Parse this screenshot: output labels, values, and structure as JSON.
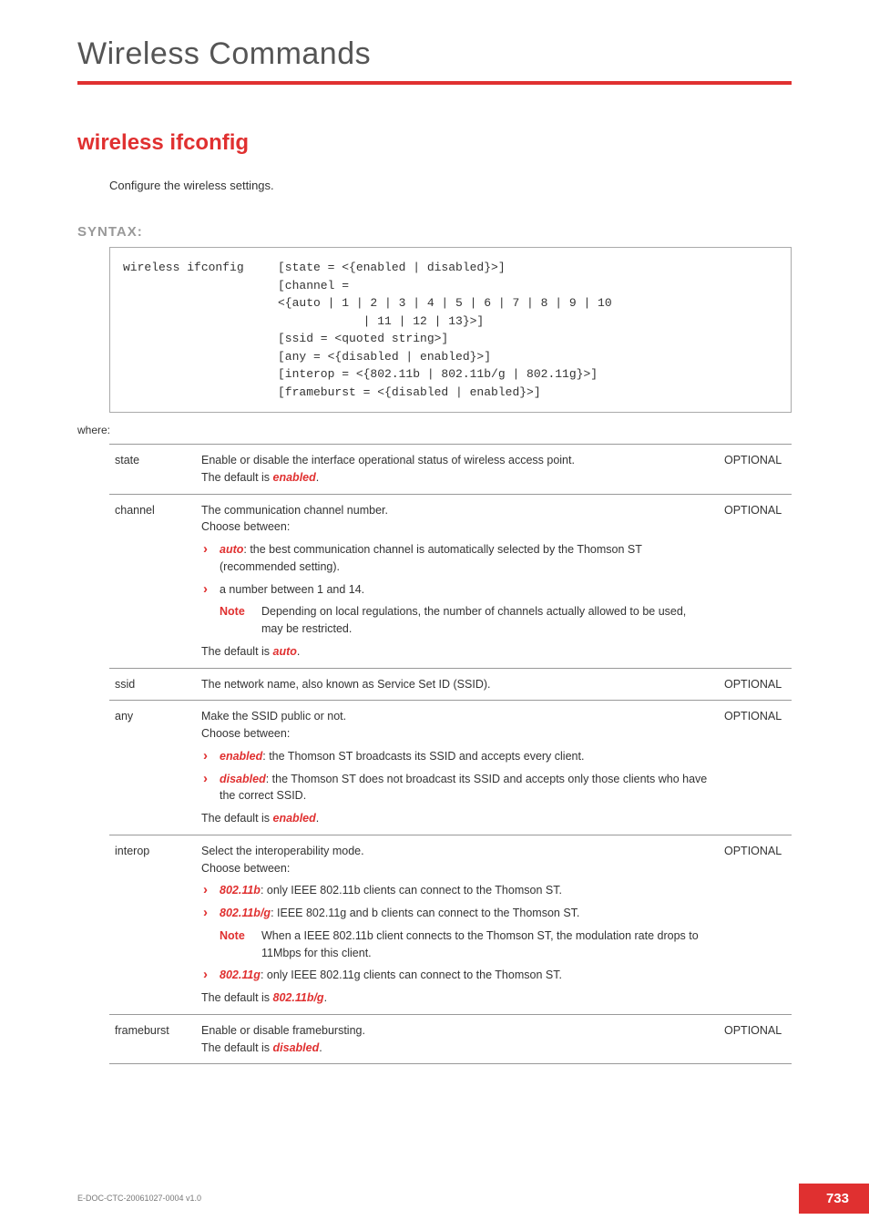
{
  "chapter": "Wireless Commands",
  "command_title": "wireless ifconfig",
  "command_desc": "Configure the wireless settings.",
  "syntax_label": "SYNTAX:",
  "syntax_cmd": "wireless ifconfig",
  "syntax_args": "[state = <{enabled | disabled}>]\n[channel =\n<{auto | 1 | 2 | 3 | 4 | 5 | 6 | 7 | 8 | 9 | 10\n            | 11 | 12 | 13}>]\n[ssid = <quoted string>]\n[any = <{disabled | enabled}>]\n[interop = <{802.11b | 802.11b/g | 802.11g}>]\n[frameburst = <{disabled | enabled}>]",
  "where_label": "where:",
  "optional_label": "OPTIONAL",
  "note_label": "Note",
  "params": {
    "state": {
      "name": "state",
      "desc_pre": "Enable or disable the interface operational status of wireless access point.",
      "default_pre": "The default is ",
      "default_val": "enabled",
      "default_post": "."
    },
    "channel": {
      "name": "channel",
      "desc_pre": "The communication channel number.",
      "choose": "Choose between:",
      "b1_em": "auto",
      "b1_txt": ": the best communication channel is automatically selected by the Thomson ST (recommended setting).",
      "b2_txt": "a number between 1 and 14.",
      "note_txt": "Depending on local regulations, the number of channels actually allowed to be used, may be restricted.",
      "default_pre": "The default is ",
      "default_val": "auto",
      "default_post": "."
    },
    "ssid": {
      "name": "ssid",
      "desc": "The network name, also known as Service Set ID (SSID)."
    },
    "any": {
      "name": "any",
      "desc_pre": "Make the SSID public or not.",
      "choose": "Choose between:",
      "b1_em": "enabled",
      "b1_txt": ": the Thomson ST broadcasts its SSID and accepts every client.",
      "b2_em": "disabled",
      "b2_txt": ": the Thomson ST does not broadcast its SSID and accepts only those clients who have the correct SSID.",
      "default_pre": "The default is ",
      "default_val": "enabled",
      "default_post": "."
    },
    "interop": {
      "name": "interop",
      "desc_pre": "Select the interoperability mode.",
      "choose": "Choose between:",
      "b1_em": "802.11b",
      "b1_txt": ": only IEEE 802.11b clients can connect to the Thomson ST.",
      "b2_em": "802.11b/g",
      "b2_txt": ": IEEE 802.11g and b clients can connect to the Thomson ST.",
      "note_txt": "When  a IEEE 802.11b client connects to the Thomson ST, the modulation rate drops to 11Mbps for this client.",
      "b3_em": "802.11g",
      "b3_txt": ": only IEEE 802.11g clients can connect to the Thomson ST.",
      "default_pre": "The default is ",
      "default_val": "802.11b/g",
      "default_post": "."
    },
    "frameburst": {
      "name": "frameburst",
      "desc_pre": "Enable or disable framebursting.",
      "default_pre": "The default is ",
      "default_val": "disabled",
      "default_post": "."
    }
  },
  "footer_doc": "E-DOC-CTC-20061027-0004 v1.0",
  "page_number": "733"
}
